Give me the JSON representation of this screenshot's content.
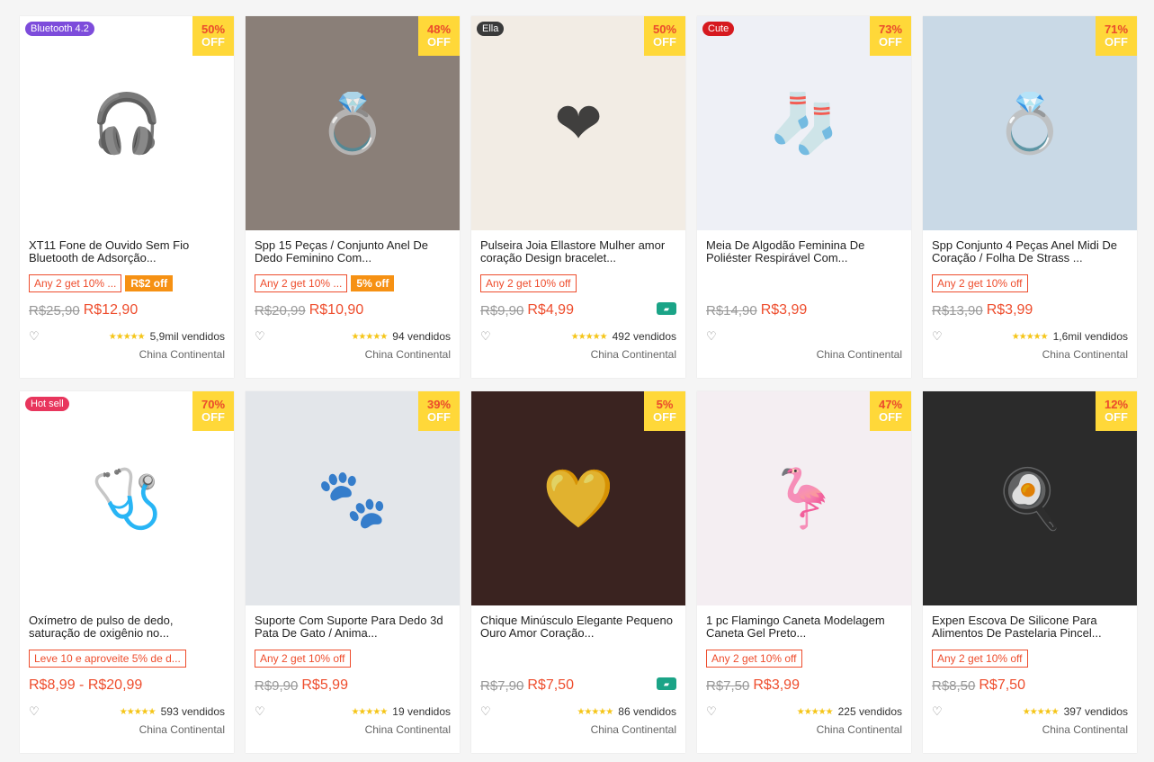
{
  "products": [
    {
      "name": "XT11 Fone de Ouvido Sem Fio Bluetooth de Adsorção...",
      "discount": "50%",
      "off": "OFF",
      "promo": "Any 2 get 10% ...",
      "promo2": "R$2 off",
      "old": "R$25,90",
      "new": "R$12,90",
      "sold": "5,9mil vendidos",
      "loc": "China Continental",
      "corner": "Bluetooth 4.2",
      "corner_color": "#7d4cdb",
      "bg": "#ffffff",
      "art": "🎧",
      "truck": false,
      "stars": "★★★★★"
    },
    {
      "name": "Spp 15 Peças / Conjunto Anel De Dedo Feminino Com...",
      "discount": "48%",
      "off": "OFF",
      "promo": "Any 2 get 10% ...",
      "promo2": "5% off",
      "old": "R$20,99",
      "new": "R$10,90",
      "sold": "94 vendidos",
      "loc": "China Continental",
      "corner": "",
      "corner_color": "",
      "bg": "#8a7f78",
      "art": "💍",
      "truck": false,
      "stars": "★★★★★"
    },
    {
      "name": "Pulseira Joia Ellastore Mulher amor coração Design bracelet...",
      "discount": "50%",
      "off": "OFF",
      "promo": "Any 2 get 10% off",
      "promo2": "",
      "old": "R$9,90",
      "new": "R$4,99",
      "sold": "492 vendidos",
      "loc": "China Continental",
      "corner": "Ella",
      "corner_color": "#3a3a3a",
      "bg": "#f2ece4",
      "art": "❤",
      "truck": true,
      "stars": "★★★★★"
    },
    {
      "name": "Meia De Algodão Feminina De Poliéster Respirável Com...",
      "discount": "73%",
      "off": "OFF",
      "promo": "",
      "promo2": "",
      "old": "R$14,90",
      "new": "R$3,99",
      "sold": "",
      "loc": "China Continental",
      "corner": "Cute",
      "corner_color": "#d6191f",
      "bg": "#eef0f6",
      "art": "🧦",
      "truck": false,
      "stars": ""
    },
    {
      "name": "Spp Conjunto 4 Peças Anel Midi De Coração / Folha De Strass ...",
      "discount": "71%",
      "off": "OFF",
      "promo": "Any 2 get 10% off",
      "promo2": "",
      "old": "R$13,90",
      "new": "R$3,99",
      "sold": "1,6mil vendidos",
      "loc": "China Continental",
      "corner": "",
      "corner_color": "",
      "bg": "#c9d9e6",
      "art": "💍",
      "truck": false,
      "stars": "★★★★★"
    },
    {
      "name": "Oxímetro de pulso de dedo, saturação de oxigênio no...",
      "discount": "70%",
      "off": "OFF",
      "promo": "Leve 10 e aproveite 5% de d...",
      "promo2": "",
      "old": "",
      "new": "R$8,99 - R$20,99",
      "sold": "593 vendidos",
      "loc": "China Continental",
      "corner": "Hot sell",
      "corner_color": "#e8365d",
      "bg": "#ffffff",
      "art": "🩺",
      "truck": false,
      "stars": "★★★★★"
    },
    {
      "name": "Suporte Com Suporte Para Dedo 3d Pata De Gato / Anima...",
      "discount": "39%",
      "off": "OFF",
      "promo": "Any 2 get 10% off",
      "promo2": "",
      "old": "R$9,90",
      "new": "R$5,99",
      "sold": "19 vendidos",
      "loc": "China Continental",
      "corner": "",
      "corner_color": "",
      "bg": "#e3e6ea",
      "art": "🐾",
      "truck": false,
      "stars": "★★★★★"
    },
    {
      "name": "Chique Minúsculo Elegante Pequeno Ouro Amor Coração...",
      "discount": "5%",
      "off": "OFF",
      "promo": "",
      "promo2": "",
      "old": "R$7,90",
      "new": "R$7,50",
      "sold": "86 vendidos",
      "loc": "China Continental",
      "corner": "",
      "corner_color": "",
      "bg": "#3a2320",
      "art": "💛",
      "truck": true,
      "stars": "★★★★★"
    },
    {
      "name": "1 pc Flamingo Caneta Modelagem Caneta Gel Preto...",
      "discount": "47%",
      "off": "OFF",
      "promo": "Any 2 get 10% off",
      "promo2": "",
      "old": "R$7,50",
      "new": "R$3,99",
      "sold": "225 vendidos",
      "loc": "China Continental",
      "corner": "",
      "corner_color": "",
      "bg": "#f4eef2",
      "art": "🦩",
      "truck": false,
      "stars": "★★★★★"
    },
    {
      "name": "Expen Escova De Silicone Para Alimentos De Pastelaria Pincel...",
      "discount": "12%",
      "off": "OFF",
      "promo": "Any 2 get 10% off",
      "promo2": "",
      "old": "R$8,50",
      "new": "R$7,50",
      "sold": "397 vendidos",
      "loc": "China Continental",
      "corner": "",
      "corner_color": "",
      "bg": "#2b2b2b",
      "art": "🍳",
      "truck": false,
      "stars": "★★★★★"
    }
  ],
  "icons": {
    "heart": "heart-outline-icon",
    "truck": "free-shipping-truck-icon"
  },
  "colors": {
    "accent": "#ee4d2d",
    "discount_bg": "#ffd839",
    "stars": "#f5c518"
  }
}
